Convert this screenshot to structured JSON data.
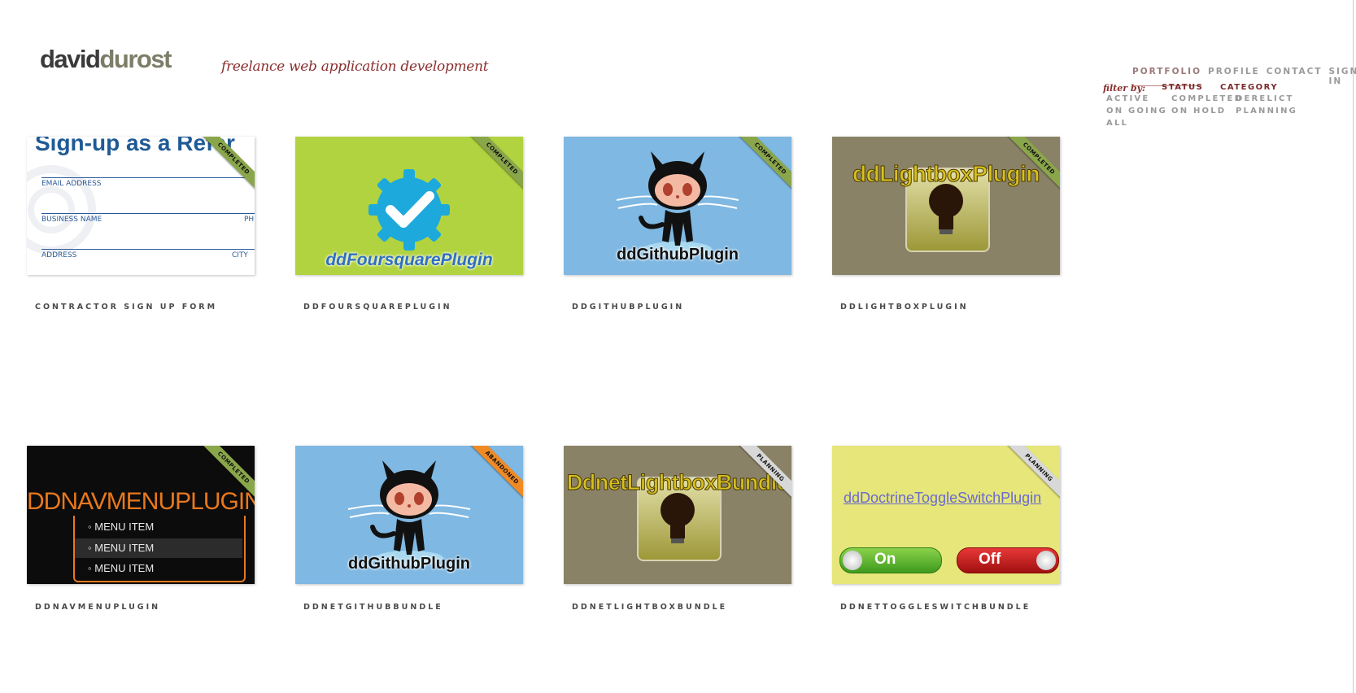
{
  "header": {
    "logo_first": "david",
    "logo_last": "durost",
    "tagline": "freelance web application development"
  },
  "nav": {
    "portfolio": "PORTFOLIO",
    "profile": "PROFILE",
    "contact": "CONTACT",
    "sign_in": "SIGN IN"
  },
  "filter": {
    "label": "filter by:",
    "status_heading": "STATUS",
    "category_heading": "CATEGORY",
    "options": {
      "active": "ACTIVE",
      "completed": "COMPLETED",
      "derelict": "DERELICT",
      "on_going": "ON GOING",
      "on_hold": "ON HOLD",
      "planning": "PLANNING",
      "all": "ALL"
    }
  },
  "projects": [
    {
      "caption": "CONTRACTOR SIGN UP FORM",
      "status": "COMPLETED",
      "thumb": {
        "heading": "Sign-up as a Refer",
        "email": "EMAIL ADDRESS",
        "business": "BUSINESS NAME",
        "ph": "PH",
        "address": "ADDRESS",
        "city": "CITY"
      }
    },
    {
      "caption": "DDFOURSQUAREPLUGIN",
      "status": "COMPLETED",
      "thumb": {
        "title": "ddFoursquarePlugin"
      }
    },
    {
      "caption": "DDGITHUBPLUGIN",
      "status": "COMPLETED",
      "thumb": {
        "title": "ddGithubPlugin"
      }
    },
    {
      "caption": "DDLIGHTBOXPLUGIN",
      "status": "COMPLETED",
      "thumb": {
        "title": "ddLightboxPlugin"
      }
    },
    {
      "caption": "DDNAVMENUPLUGIN",
      "status": "COMPLETED",
      "thumb": {
        "title": "DDNAVMENUPLUGIN",
        "items": [
          "MENU ITEM",
          "MENU ITEM",
          "MENU ITEM"
        ]
      }
    },
    {
      "caption": "DDNETGITHUBBUNDLE",
      "status": "ABANDONED",
      "thumb": {
        "title": "ddGithubPlugin"
      }
    },
    {
      "caption": "DDNETLIGHTBOXBUNDLE",
      "status": "PLANNING",
      "thumb": {
        "title": "DdnetLightboxBundle"
      }
    },
    {
      "caption": "DDNETTOGGLESWITCHBUNDLE",
      "status": "PLANNING",
      "thumb": {
        "title": "ddDoctrineToggleSwitchPlugin",
        "on": "On",
        "off": "Off"
      }
    }
  ],
  "colors": {
    "completed": "#8aa64a",
    "abandoned": "#f08a24",
    "planning": "#d8d8d8",
    "brand_red": "#8a2f2f"
  }
}
